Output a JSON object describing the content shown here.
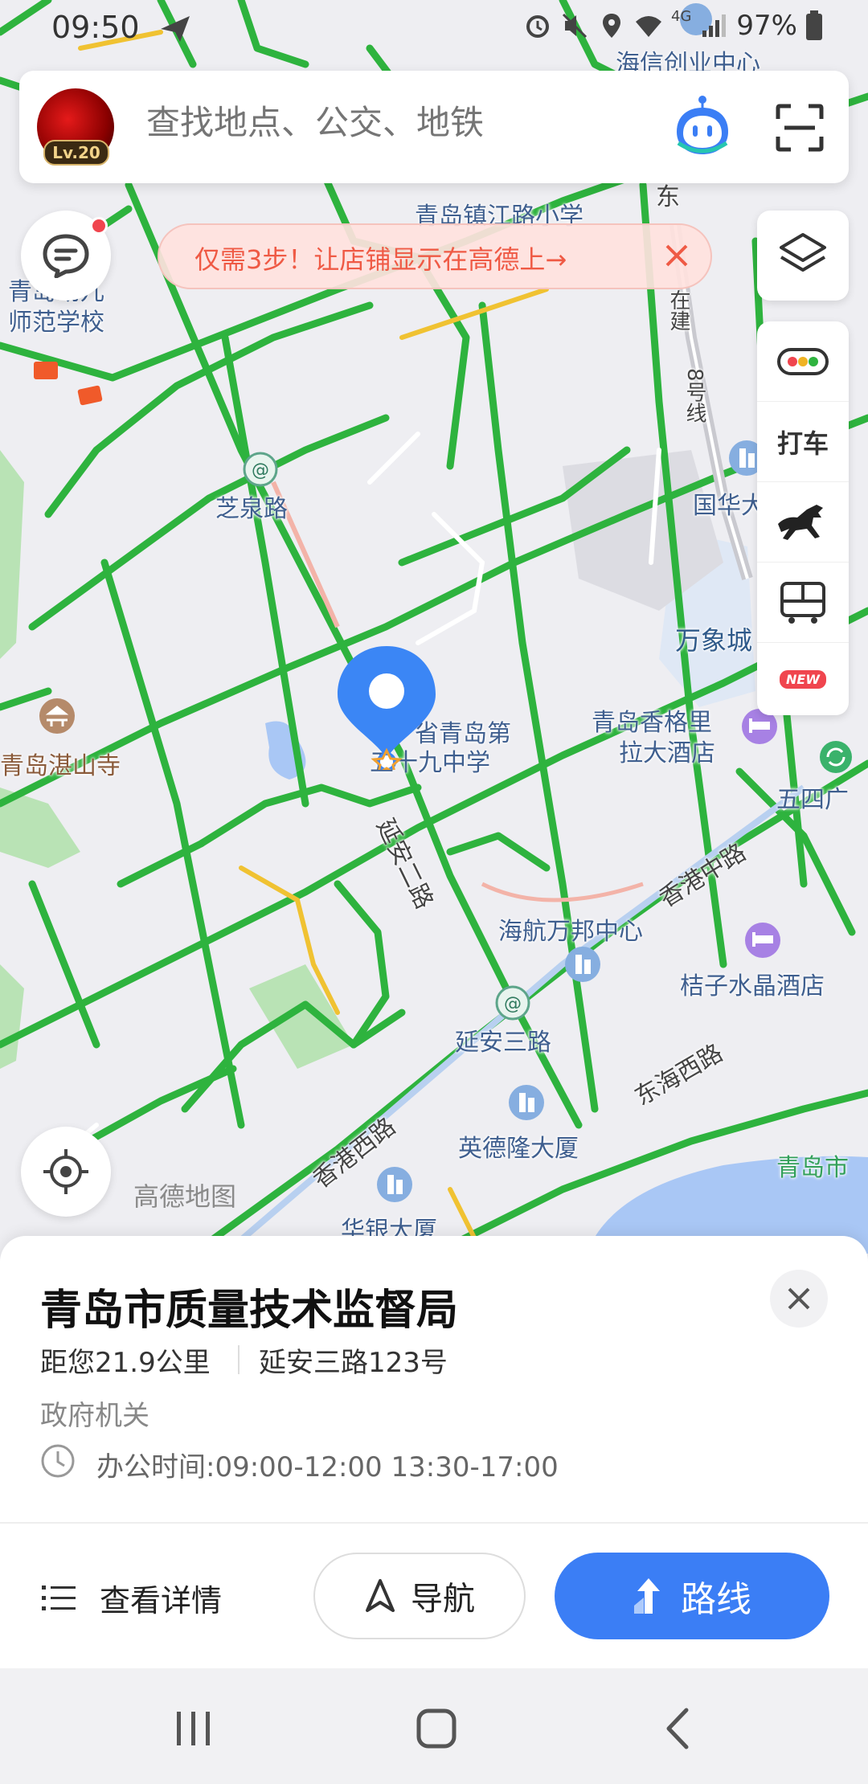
{
  "status_bar": {
    "time": "09:50",
    "network": "4G",
    "battery": "97%"
  },
  "search": {
    "placeholder": "查找地点、公交、地铁",
    "level": "Lv.20"
  },
  "banner": {
    "text": "仅需3步！让店铺显示在高德上→"
  },
  "toolbar": {
    "taxi_label": "打车",
    "new_badge": "NEW"
  },
  "map": {
    "brand": "高德地图",
    "labels": [
      {
        "text": "海信创业中心",
        "color": "blue"
      },
      {
        "text": "青岛镇江路小学",
        "color": "blue"
      },
      {
        "text": "东",
        "color": "dark"
      },
      {
        "text": "在建",
        "color": "dark"
      },
      {
        "text": "8号线",
        "color": "dark"
      },
      {
        "text": "青岛幼儿",
        "color": "blue"
      },
      {
        "text": "师范学校",
        "color": "blue"
      },
      {
        "text": "芝泉路",
        "color": "blue"
      },
      {
        "text": "国华大",
        "color": "blue"
      },
      {
        "text": "万象城",
        "color": "blue"
      },
      {
        "text": "青岛香格里",
        "color": "blue"
      },
      {
        "text": "拉大酒店",
        "color": "blue"
      },
      {
        "text": "省青岛第",
        "color": "blue"
      },
      {
        "text": "五十九中学",
        "color": "blue"
      },
      {
        "text": "青岛湛山寺",
        "color": "brown"
      },
      {
        "text": "延安二路",
        "color": "dark"
      },
      {
        "text": "五四广",
        "color": "blue"
      },
      {
        "text": "香港中路",
        "color": "dark"
      },
      {
        "text": "海航万邦中心",
        "color": "blue"
      },
      {
        "text": "桔子水晶酒店",
        "color": "blue"
      },
      {
        "text": "延安三路",
        "color": "blue"
      },
      {
        "text": "东海西路",
        "color": "dark"
      },
      {
        "text": "英德隆大厦",
        "color": "blue"
      },
      {
        "text": "香港西路",
        "color": "dark"
      },
      {
        "text": "青岛市",
        "color": "green"
      },
      {
        "text": "华银大厦",
        "color": "blue"
      }
    ]
  },
  "poi": {
    "name": "青岛市质量技术监督局",
    "distance": "距您21.9公里",
    "address": "延安三路123号",
    "category": "政府机关",
    "hours": "办公时间:09:00-12:00 13:30-17:00"
  },
  "actions": {
    "details": "查看详情",
    "navigate": "导航",
    "route": "路线"
  },
  "colors": {
    "road": "#2eb33e",
    "accent": "#3b7ef5",
    "banner_text": "#ef5a45"
  }
}
